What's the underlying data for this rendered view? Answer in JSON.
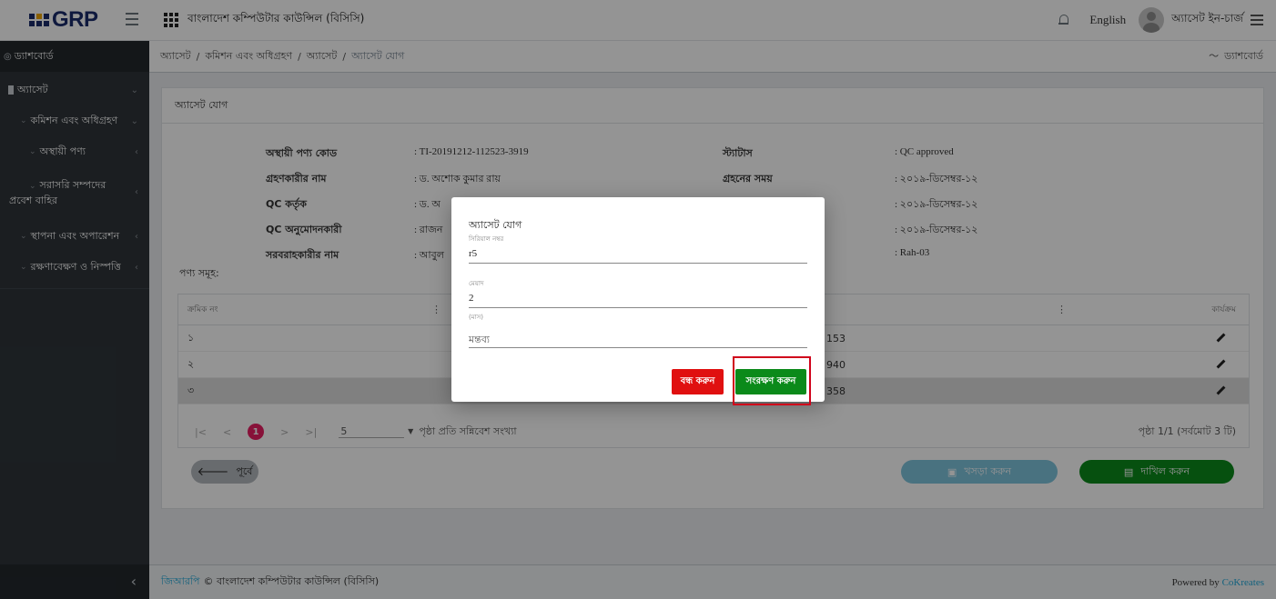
{
  "header": {
    "logo": "GRP",
    "org_name": "বাংলাদেশ কম্পিউটার কাউন্সিল (বিসিসি)",
    "language": "English",
    "user_role": "অ্যাসেট ইন-চার্জ"
  },
  "sidebar": {
    "dashboard": "ড্যাশবোর্ড",
    "asset": "অ্যাসেট",
    "commission": "কমিশন এবং অধিগ্রহণ",
    "temp_product": "অস্থায়ী পণ্য",
    "direct_entry": "সরাসরি সম্পদের প্রবেশ বাহির",
    "install": "স্থাপনা এবং অপারেশন",
    "maintenance": "রক্ষণাবেক্ষণ ও নিস্পত্তি"
  },
  "breadcrumb": {
    "item1": "অ্যাসেট",
    "item2": "কমিশন এবং অধিগ্রহণ",
    "item3": "অ্যাসেট",
    "current": "অ্যাসেট যোগ",
    "right": "ড্যাশবোর্ড"
  },
  "card": {
    "title": "অ্যাসেট যোগ",
    "info": {
      "temp_code_label": "অস্থায়ী পণ্য কোড",
      "temp_code_value": ": TI-20191212-112523-3919",
      "receiver_label": "গ্রহণকারীর নাম",
      "receiver_value": ": ড. অশোক কুমার রায়",
      "qc_by_label": "QC কর্তৃক",
      "qc_by_value": ": ড. অ",
      "qc_approver_label": "QC অনুমোদনকারী",
      "qc_approver_value": ": রাজন",
      "supplier_label": "সরবরাহকারীর নাম",
      "supplier_value": ": আবুল",
      "status_label": "স্ট্যাটাস",
      "status_value": ": QC approved",
      "receive_time_label": "গ্রহনের সময়",
      "receive_time_value": ": ২০১৯-ডিসেম্বর-১২",
      "date3_value": ": ২০১৯-ডিসেম্বর-১২",
      "date4_value": ": ২০১৯-ডিসেম্বর-১২",
      "ref_value": ": Rah-03"
    },
    "items_title": "পণ্য সমূহ:",
    "table": {
      "col_serial": "ক্রমিক নং",
      "col_action": "কার্যক্রম",
      "col_menu": "⋮",
      "rows": [
        {
          "serial": "১",
          "tail": "153"
        },
        {
          "serial": "২",
          "tail": "940"
        },
        {
          "serial": "৩",
          "tail": "358"
        }
      ]
    },
    "pager": {
      "first": "|<",
      "prev": "<",
      "current": "1",
      "next": ">",
      "last": ">|",
      "page_size": "5",
      "per_page_label": "পৃষ্ঠা প্রতি সন্নিবেশ সংখ্যা",
      "info": "পৃষ্ঠা 1/1 (সর্বমোট 3 টি)"
    },
    "buttons": {
      "prev": "পূর্বে",
      "draft": "খসড়া করুন",
      "submit": "দাখিল করুন"
    }
  },
  "footer": {
    "brand": "জিআরপি",
    "copyright": "© বাংলাদেশ কম্পিউটার কাউন্সিল (বিসিসি)",
    "powered": "Powered by",
    "company": "CoKreates"
  },
  "modal": {
    "title": "অ্যাসেট যোগ",
    "serial_label": "সিরিয়াল নম্বর",
    "serial_value": "r5",
    "duration_label": "মেয়াদ",
    "duration_value": "2",
    "duration_hint": "(মাস)",
    "remarks_placeholder": "মন্তব্য",
    "close_btn": "বন্ধ করুন",
    "save_btn": "সংরক্ষণ করুন"
  }
}
